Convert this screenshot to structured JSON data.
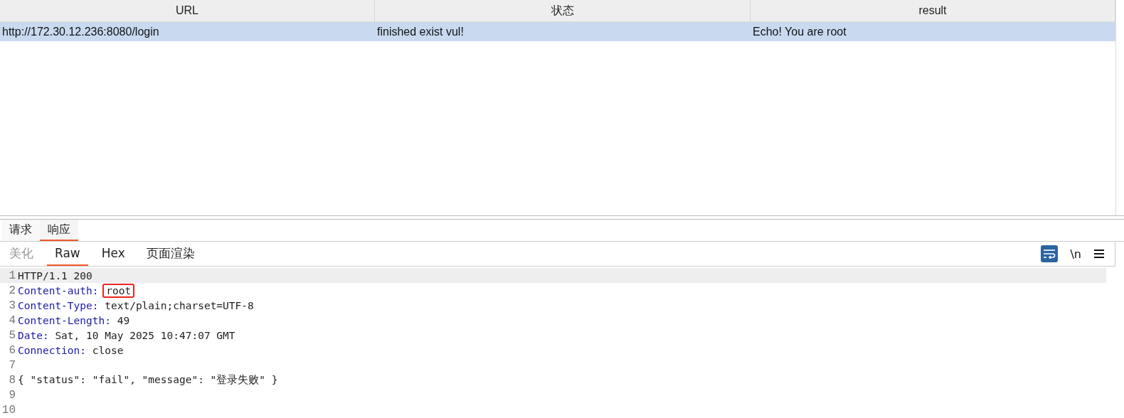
{
  "table": {
    "columns": [
      "URL",
      "状态",
      "result"
    ],
    "rows": [
      {
        "cells": [
          "http://172.30.12.236:8080/login",
          "finished exist vul!",
          "Echo! You are root"
        ],
        "selected": true
      }
    ]
  },
  "tabs": [
    {
      "label": "请求",
      "selected": false
    },
    {
      "label": "响应",
      "selected": true
    }
  ],
  "view_tabs": [
    {
      "label": "美化",
      "selected": false,
      "disabled": true
    },
    {
      "label": "Raw",
      "selected": true,
      "disabled": false
    },
    {
      "label": "Hex",
      "selected": false,
      "disabled": false
    },
    {
      "label": "页面渲染",
      "selected": false,
      "disabled": false
    }
  ],
  "toolbar": {
    "wrap_on": true,
    "newline_label": "\\n",
    "newline_on": false
  },
  "editor": {
    "lines": [
      {
        "number": "1",
        "value": "HTTP/1.1 200",
        "current": true
      },
      {
        "number": "2",
        "key": "Content-auth",
        "sep": ":",
        "value": "root",
        "boxed": true
      },
      {
        "number": "3",
        "key": "Content-Type",
        "sep": ":",
        "value": "text/plain;charset=UTF-8"
      },
      {
        "number": "4",
        "key": "Content-Length",
        "sep": ":",
        "value": "49"
      },
      {
        "number": "5",
        "key": "Date",
        "sep": ":",
        "value": "Sat, 10 May 2025 10:47:07 GMT"
      },
      {
        "number": "6",
        "key": "Connection",
        "sep": ":",
        "value": "close"
      },
      {
        "number": "7"
      },
      {
        "number": "8",
        "value": "{ \"status\": \"fail\", \"message\": \"登录失败\" }"
      },
      {
        "number": "9"
      },
      {
        "number": "10"
      }
    ]
  }
}
